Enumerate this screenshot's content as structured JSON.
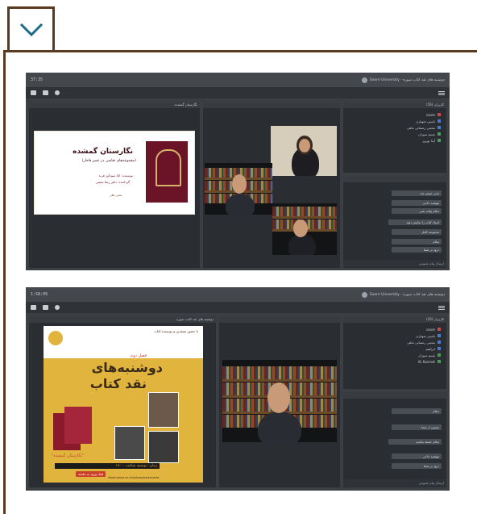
{
  "toggle": {
    "icon": "chevron-down-icon",
    "color": "#1a6a8a"
  },
  "frame": {
    "border_color": "#5a3a20"
  },
  "screenshots": [
    {
      "time": "37:35",
      "title": "دوشنبه های نقد کتاب سوره - Soore University",
      "presentation_header": "نگارستان گمشده",
      "slide": {
        "title": "نگارستان گمشده",
        "subtitle": "(مجموعه‌های نقاشی در عصر قاجار)",
        "line1": "نویسنده: ایلا سودآور فربد",
        "line2": "گرداننده: دکتر رضا نعیمی",
        "line3": "نشر نظر"
      },
      "users_header": "کاربران (16)",
      "users": [
        "soore",
        "یاسین شهبازی",
        "مجتبی رمضانی ماهی",
        "شبنم سوران",
        "آیدا بهروز"
      ],
      "chat": [
        "مدیر عوض شد",
        "مهشید حاجی",
        "سلام وقت بخیر",
        "استاد کتاب را نمایش دهید",
        "مجموعه کامل",
        "سلام",
        "درود بر شما"
      ],
      "chat_placeholder": "ارسال پیام عمومی"
    },
    {
      "time": "1:58:09",
      "title": "دوشنبه های نقد کتاب سوره - Soore University",
      "presentation_header": "دوشنبه های نقد کتاب سوره",
      "users_header": "کاربران (10)",
      "users": [
        "soore",
        "یاسین شهبازی",
        "مجتبی رمضانی ماهی",
        "ابراهیم",
        "شبنم سوران",
        "Ali Basmat"
      ],
      "poster": {
        "season": "فصل دوم",
        "headline1": "دوشنبه‌های",
        "headline2": "نقد کتاب",
        "top_note": "با حضور منتقدین و نویسنده کتاب",
        "book_title": "\"نگارستان گمشده\"",
        "schedule": "زمان: دوشنبه ساعت ۱۸:۰۰",
        "cta": "لینک ورود به جلسه",
        "url": "elkad.soore.ac.ir/s/show/bookreview"
      },
      "chat": [
        "سلام",
        "ممنون از شما",
        "سلام خسته نباشید",
        "مهشید حاجی",
        "درود بر شما"
      ],
      "chat_placeholder": "ارسال پیام عمومی"
    }
  ]
}
